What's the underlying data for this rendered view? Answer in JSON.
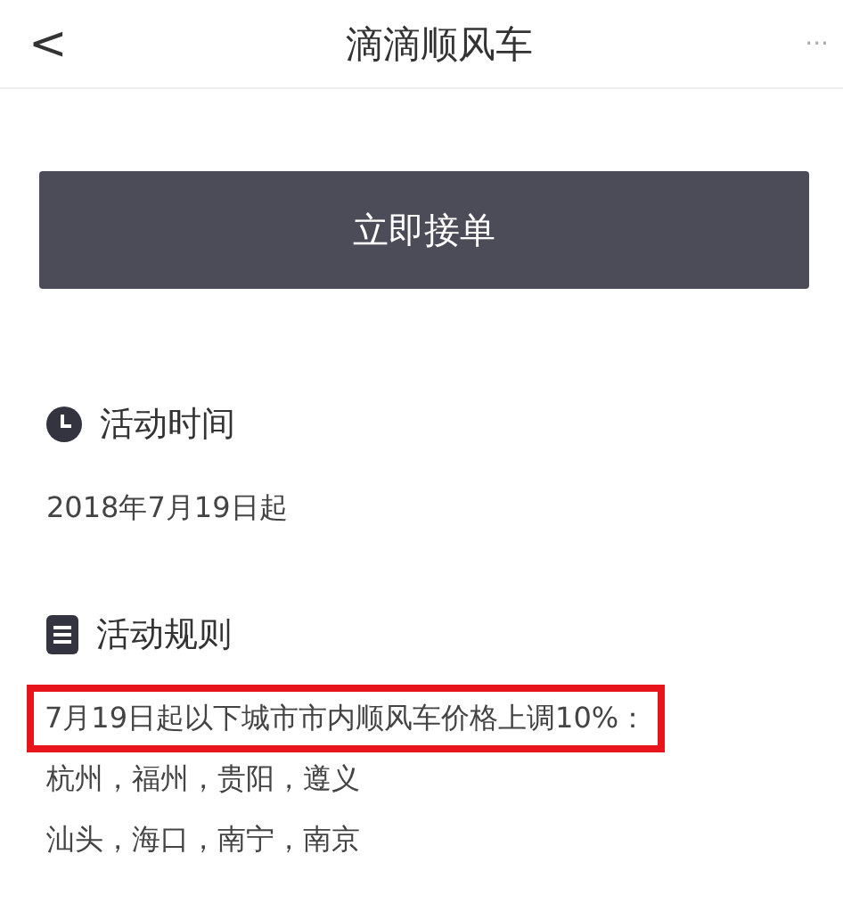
{
  "header": {
    "back": "<",
    "title": "滴滴顺风车",
    "menu": "···"
  },
  "action_button": {
    "label": "立即接单"
  },
  "sections": [
    {
      "kind": "time",
      "heading": "活动时间",
      "lines": [
        {
          "text": "2018年7月19日起",
          "highlighted": false
        }
      ]
    },
    {
      "kind": "rules",
      "heading": "活动规则",
      "lines": [
        {
          "text": "7月19日起以下城市市内顺风车价格上调10%：",
          "highlighted": true
        },
        {
          "text": "杭州，福州，贵阳，遵义",
          "highlighted": false
        },
        {
          "text": "汕头，海口，南宁，南京",
          "highlighted": false
        }
      ]
    }
  ]
}
